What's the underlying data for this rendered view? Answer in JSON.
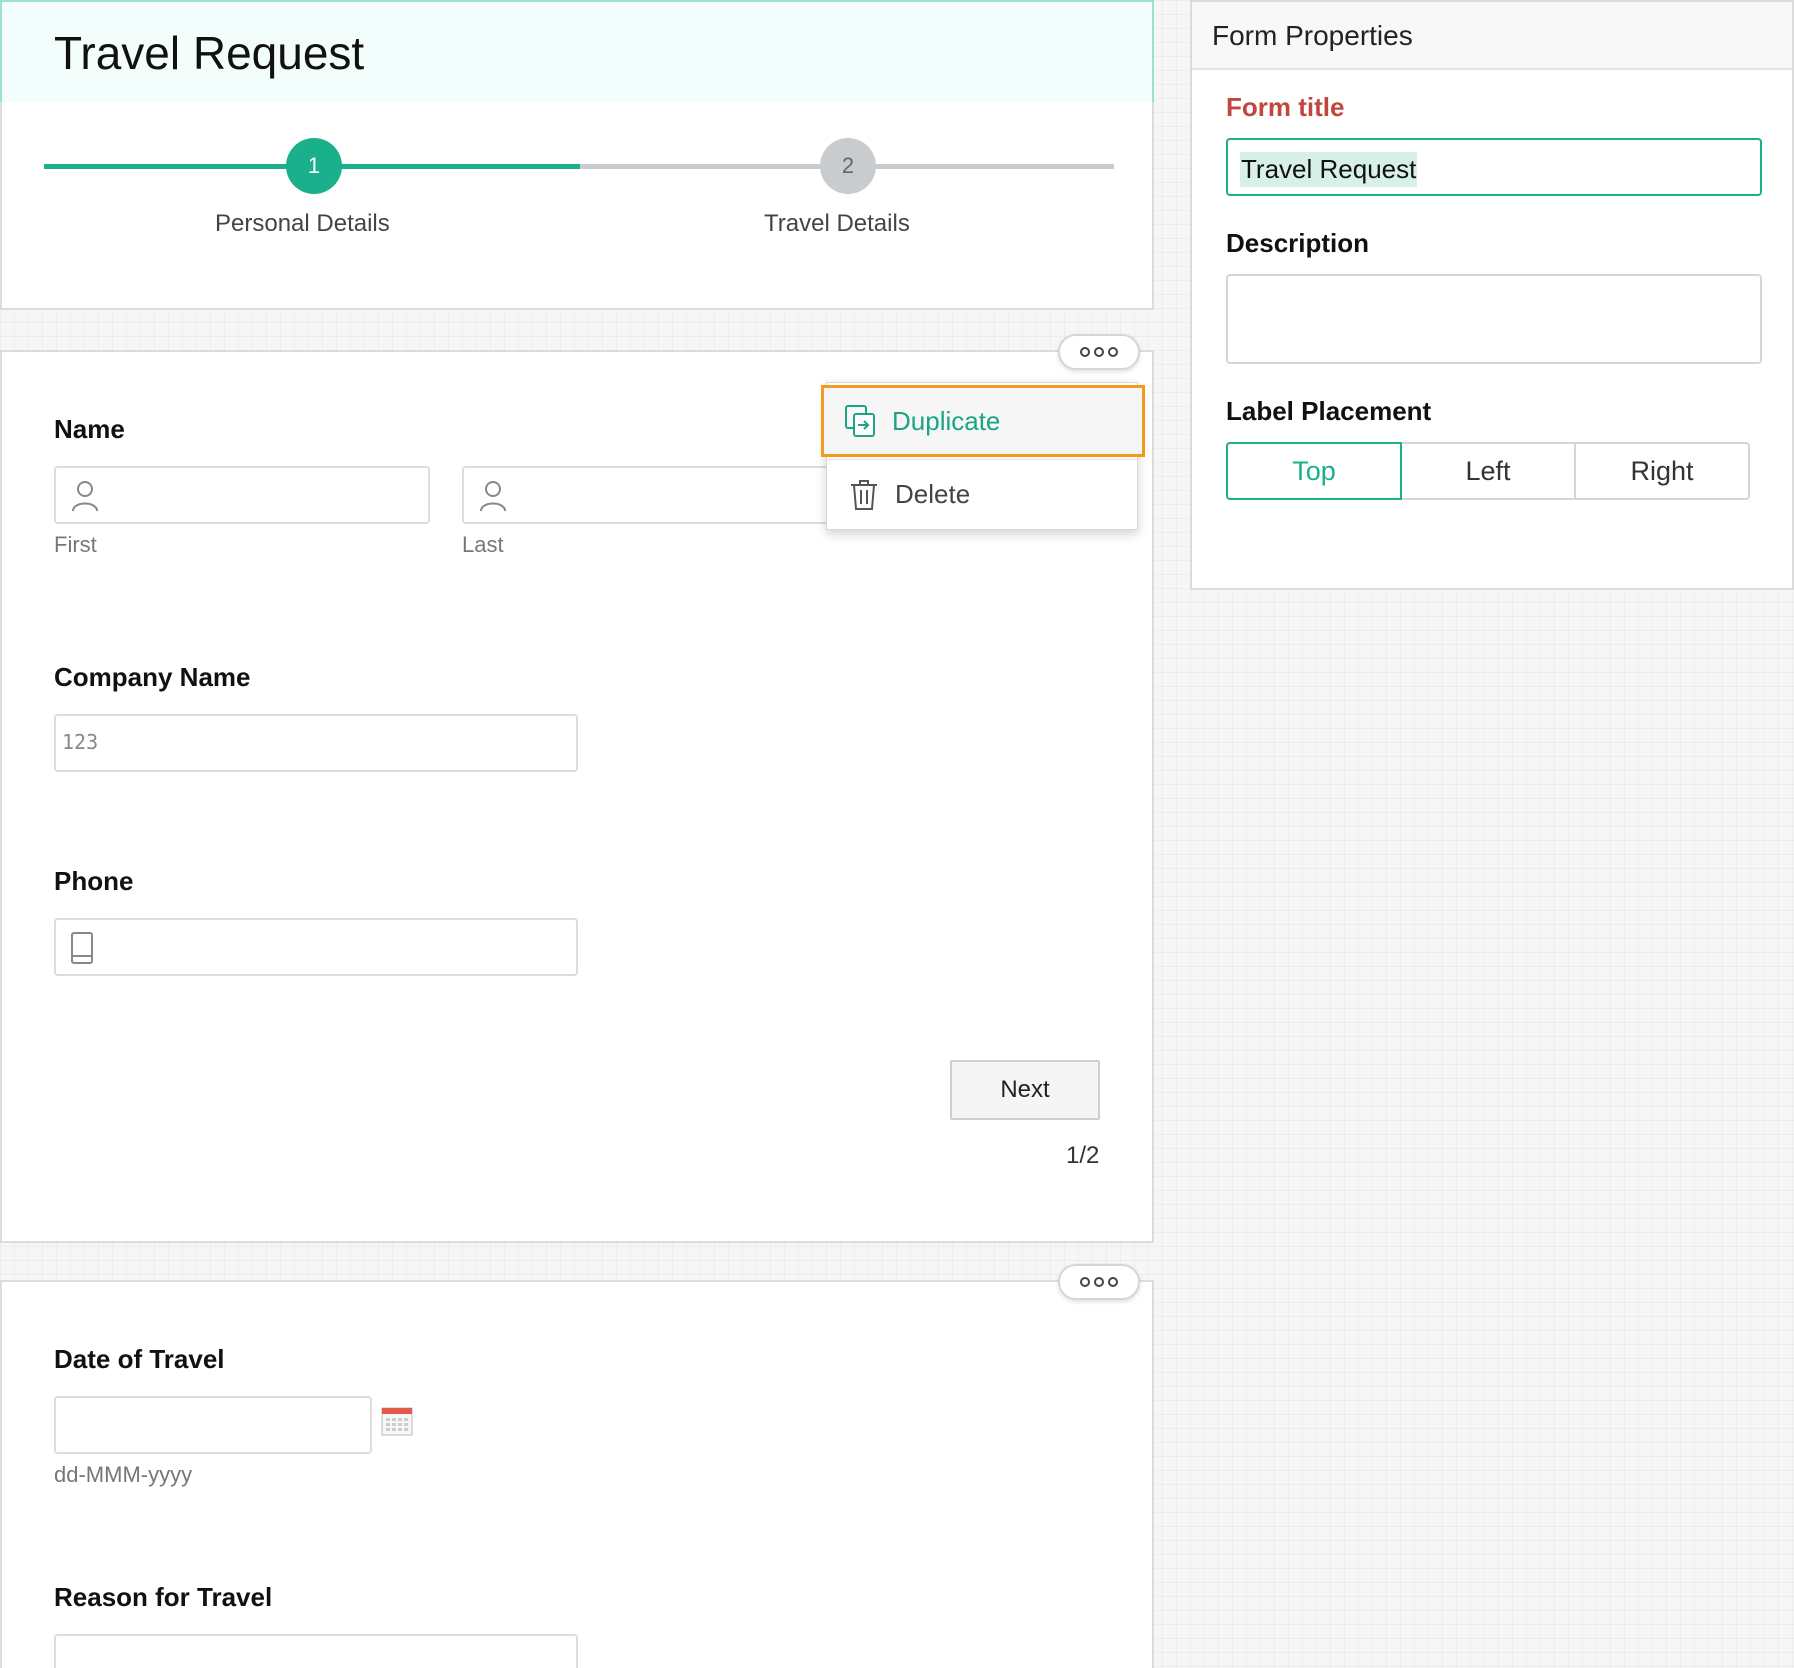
{
  "form": {
    "title": "Travel Request"
  },
  "steps": [
    {
      "number": "1",
      "label": "Personal Details",
      "state": "active"
    },
    {
      "number": "2",
      "label": "Travel Details",
      "state": "inactive"
    }
  ],
  "page1": {
    "name_field": {
      "label": "Name",
      "first_sublabel": "First",
      "last_sublabel": "Last"
    },
    "company_field": {
      "label": "Company Name",
      "icon_text": "123"
    },
    "phone_field": {
      "label": "Phone"
    },
    "next_button": "Next",
    "page_indicator": "1/2"
  },
  "context_menu": {
    "items": [
      {
        "label": "Duplicate",
        "icon": "duplicate-icon",
        "highlighted": true
      },
      {
        "label": "Delete",
        "icon": "trash-icon",
        "highlighted": false
      }
    ]
  },
  "page2": {
    "date_field": {
      "label": "Date of Travel",
      "format_hint": "dd-MMM-yyyy"
    },
    "reason_field": {
      "label": "Reason for Travel"
    }
  },
  "properties": {
    "header": "Form Properties",
    "form_title_label": "Form title",
    "form_title_value": "Travel Request",
    "description_label": "Description",
    "description_value": "",
    "label_placement_label": "Label Placement",
    "label_placement_options": [
      "Top",
      "Left",
      "Right"
    ],
    "label_placement_selected": "Top"
  },
  "colors": {
    "accent": "#1ab08c",
    "required_label": "#c0473f",
    "menu_highlight_border": "#f39a1f",
    "step_inactive": "#c9cccf"
  }
}
